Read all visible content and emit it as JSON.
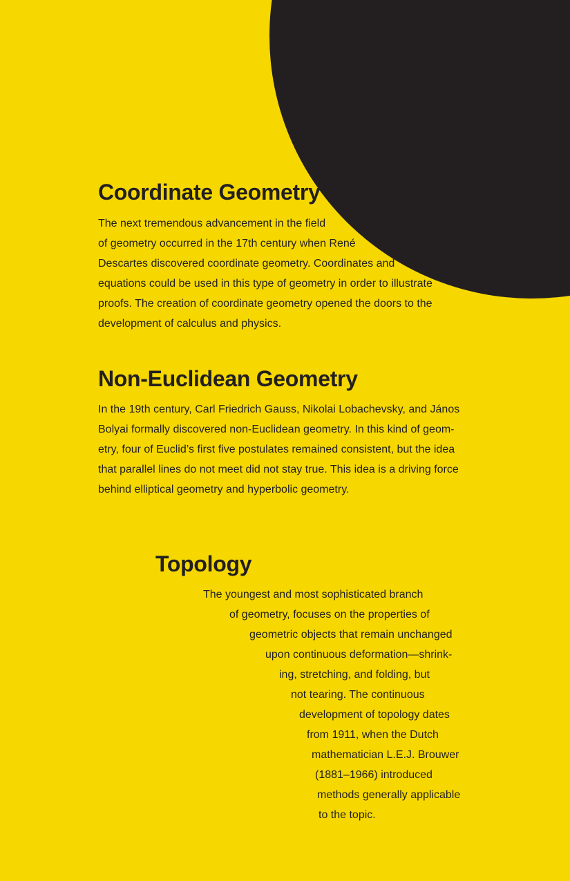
{
  "colors": {
    "background": "#f6d800",
    "ink": "#231f20",
    "disc": "#231f20"
  },
  "sections": [
    {
      "heading": "Coordinate Geometry",
      "lines": [
        "The next tremendous advancement in the field",
        "of geometry occurred in the 17th century when René",
        "Descartes discovered coordinate geometry. Coordinates and",
        "equations could be used in this type of geometry in order to illustrate",
        "proofs. The creation of coordinate geometry opened the doors to the",
        "development of calculus and physics."
      ]
    },
    {
      "heading": "Non-Euclidean Geometry",
      "lines": [
        "In the 19th century, Carl Friedrich Gauss, Nikolai Lobachevsky, and János",
        "Bolyai formally discovered non-Euclidean geometry. In this kind of geom-",
        "etry, four of Euclid’s first five postulates remained consistent, but the idea",
        "that parallel lines do not meet did not stay true. This idea is a driving force",
        "behind elliptical geometry and hyperbolic geometry."
      ]
    },
    {
      "heading": "Topology",
      "lines": [
        "The youngest and most sophisticated branch",
        "of geometry, focuses on the properties of",
        "geometric objects that remain unchanged",
        "upon continuous deformation—shrink-",
        "ing, stretching, and folding, but",
        "not tearing. The continuous",
        "development of topology dates",
        "from 1911, when the Dutch",
        "mathematician L.E.J. Brouwer",
        "(1881–1966) introduced",
        "methods generally applicable",
        "to the topic."
      ]
    }
  ]
}
